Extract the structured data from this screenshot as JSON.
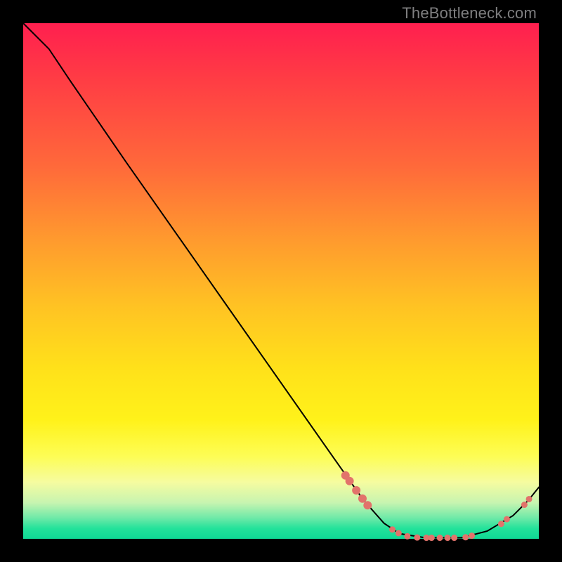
{
  "watermark": "TheBottleneck.com",
  "chart_data": {
    "type": "line",
    "title": "",
    "xlabel": "",
    "ylabel": "",
    "xlim": [
      0,
      100
    ],
    "ylim": [
      0,
      100
    ],
    "grid": false,
    "legend": false,
    "line": {
      "color": "#000000",
      "width": 2,
      "points": [
        {
          "x": 0.0,
          "y": 100.0
        },
        {
          "x": 5.0,
          "y": 95.0
        },
        {
          "x": 9.0,
          "y": 89.0
        },
        {
          "x": 20.0,
          "y": 73.0
        },
        {
          "x": 40.0,
          "y": 44.5
        },
        {
          "x": 60.0,
          "y": 16.0
        },
        {
          "x": 66.0,
          "y": 7.5
        },
        {
          "x": 70.0,
          "y": 3.0
        },
        {
          "x": 73.0,
          "y": 1.0
        },
        {
          "x": 78.0,
          "y": 0.2
        },
        {
          "x": 85.0,
          "y": 0.2
        },
        {
          "x": 90.0,
          "y": 1.5
        },
        {
          "x": 95.0,
          "y": 4.5
        },
        {
          "x": 98.0,
          "y": 7.5
        },
        {
          "x": 100.0,
          "y": 10.0
        }
      ]
    },
    "markers": {
      "color": "#e2736b",
      "radius_large": 6,
      "radius_small": 4.5,
      "points": [
        {
          "x": 62.5,
          "y": 12.3,
          "r": "large"
        },
        {
          "x": 63.3,
          "y": 11.2,
          "r": "large"
        },
        {
          "x": 64.6,
          "y": 9.4,
          "r": "large"
        },
        {
          "x": 65.8,
          "y": 7.8,
          "r": "large"
        },
        {
          "x": 66.8,
          "y": 6.5,
          "r": "large"
        },
        {
          "x": 71.6,
          "y": 1.8,
          "r": "small"
        },
        {
          "x": 72.8,
          "y": 1.1,
          "r": "small"
        },
        {
          "x": 74.5,
          "y": 0.5,
          "r": "small"
        },
        {
          "x": 76.4,
          "y": 0.25,
          "r": "small"
        },
        {
          "x": 78.2,
          "y": 0.2,
          "r": "small"
        },
        {
          "x": 79.2,
          "y": 0.2,
          "r": "small"
        },
        {
          "x": 80.8,
          "y": 0.2,
          "r": "small"
        },
        {
          "x": 82.3,
          "y": 0.2,
          "r": "small"
        },
        {
          "x": 83.6,
          "y": 0.2,
          "r": "small"
        },
        {
          "x": 85.8,
          "y": 0.3,
          "r": "small"
        },
        {
          "x": 87.0,
          "y": 0.6,
          "r": "small"
        },
        {
          "x": 92.7,
          "y": 2.9,
          "r": "small"
        },
        {
          "x": 93.8,
          "y": 3.8,
          "r": "small"
        },
        {
          "x": 97.2,
          "y": 6.6,
          "r": "small"
        },
        {
          "x": 98.1,
          "y": 7.7,
          "r": "small"
        }
      ]
    }
  }
}
